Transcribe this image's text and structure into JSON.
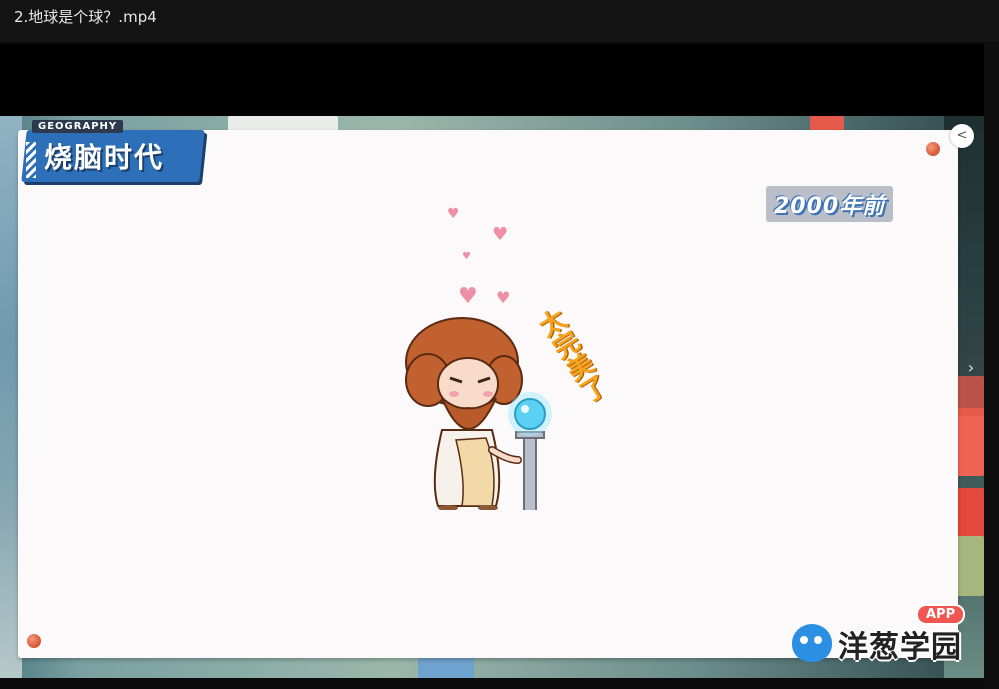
{
  "window": {
    "title": "2.地球是个球？.mp4"
  },
  "video": {
    "logo": {
      "tag": "GEOGRAPHY",
      "title": "烧脑时代"
    },
    "era_label": "2000年前",
    "speech_text": "太完美了",
    "brand": {
      "app_badge": "APP",
      "name": "洋葱学园"
    },
    "controls": {
      "share_icon": "share-icon",
      "next_icon": "chevron-right-icon"
    }
  }
}
